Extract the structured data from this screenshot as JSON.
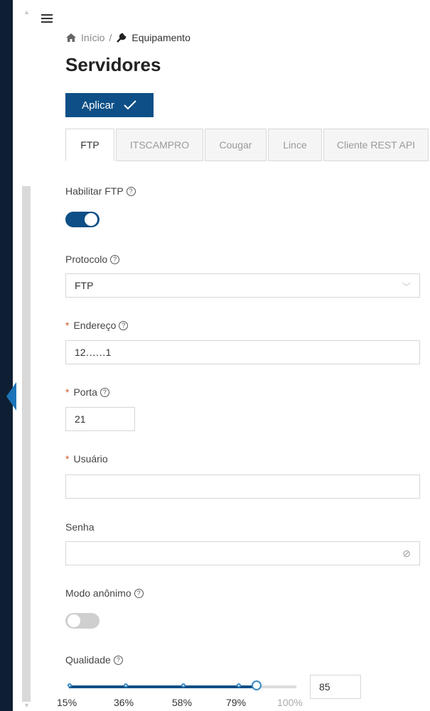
{
  "breadcrumb": {
    "home": "Início",
    "separator": "/",
    "current": "Equipamento"
  },
  "page_title": "Servidores",
  "apply_label": "Aplicar",
  "tabs": [
    {
      "label": "FTP",
      "active": true
    },
    {
      "label": "ITSCAMPRO",
      "active": false
    },
    {
      "label": "Cougar",
      "active": false
    },
    {
      "label": "Lince",
      "active": false
    },
    {
      "label": "Cliente REST API",
      "active": false
    }
  ],
  "form": {
    "habilitar_ftp": {
      "label": "Habilitar FTP",
      "enabled": true
    },
    "protocolo": {
      "label": "Protocolo",
      "value": "FTP"
    },
    "endereco": {
      "label": "Endereço",
      "required_mark": "*",
      "value": "12‥‥‥1"
    },
    "porta": {
      "label": "Porta",
      "required_mark": "*",
      "value": "21"
    },
    "usuario": {
      "label": "Usuário",
      "required_mark": "*",
      "value": ""
    },
    "senha": {
      "label": "Senha",
      "value": ""
    },
    "modo_anonimo": {
      "label": "Modo anônimo",
      "enabled": false
    },
    "qualidade": {
      "label": "Qualidade",
      "value": "85",
      "level_percent": 85,
      "marks": [
        "15%",
        "36%",
        "58%",
        "79%",
        "100%"
      ]
    }
  },
  "colors": {
    "accent": "#0d4f86",
    "required": "#d05a2a",
    "rail": "#0f1f33"
  },
  "icons": {
    "menu": "hamburger-icon",
    "home": "home-icon",
    "wrench": "wrench-icon",
    "help": "help-circle-icon",
    "eye": "eye-off-icon",
    "check": "check-icon"
  }
}
